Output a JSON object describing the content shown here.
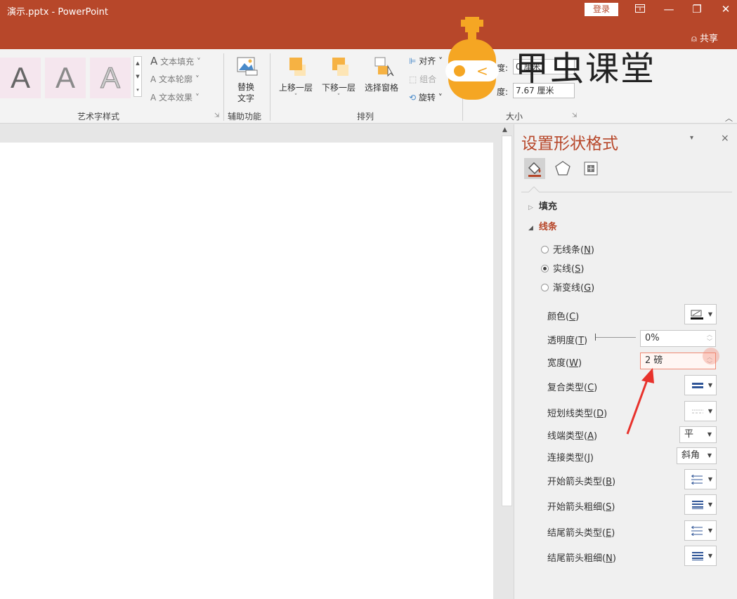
{
  "titlebar": {
    "title": "演示.pptx  -  PowerPoint",
    "login": "登录",
    "share": "共享",
    "restore_icon": "ribbon-display-icon",
    "minimize": "—",
    "maximize": "❐",
    "close": "✕"
  },
  "ribbon": {
    "wordart": {
      "letter": "A",
      "text_fill": "文本填充",
      "text_outline": "文本轮廓",
      "text_effects": "文本效果",
      "group_label": "艺术字样式"
    },
    "accessibility": {
      "alt_text_line1": "替换",
      "alt_text_line2": "文字",
      "group_label": "辅助功能"
    },
    "arrange": {
      "bring_forward": "上移一层",
      "send_backward": "下移一层",
      "selection_pane": "选择窗格",
      "align": "对齐",
      "group": "组合",
      "rotate": "旋转",
      "group_label": "排列"
    },
    "size": {
      "height_label": "度:",
      "height_value": "0 厘米",
      "width_label": "度:",
      "width_value": "7.67 厘米",
      "group_label": "大小"
    }
  },
  "watermark": {
    "text": "甲虫课堂"
  },
  "pane": {
    "title": "设置形状格式",
    "tabs": [
      "fill-line",
      "effects",
      "size-properties"
    ],
    "fill_section": "填充",
    "line_section": "线条",
    "line_options": [
      {
        "label": "无线条(",
        "key": "N",
        "selected": false
      },
      {
        "label": "实线(",
        "key": "S",
        "selected": true
      },
      {
        "label": "渐变线(",
        "key": "G",
        "selected": false
      }
    ],
    "props": {
      "color": {
        "label": "颜色(",
        "key": "C"
      },
      "transparency": {
        "label": "透明度(",
        "key": "T",
        "value": "0%"
      },
      "width": {
        "label": "宽度(",
        "key": "W",
        "value": "2 磅"
      },
      "compound": {
        "label": "复合类型(",
        "key": "C"
      },
      "dash": {
        "label": "短划线类型(",
        "key": "D"
      },
      "cap": {
        "label": "线端类型(",
        "key": "A",
        "value": "平"
      },
      "join": {
        "label": "连接类型(",
        "key": "J",
        "value": "斜角"
      },
      "begin_arrow_type": {
        "label": "开始箭头类型(",
        "key": "B"
      },
      "begin_arrow_size": {
        "label": "开始箭头粗细(",
        "key": "S"
      },
      "end_arrow_type": {
        "label": "结尾箭头类型(",
        "key": "E"
      },
      "end_arrow_size": {
        "label": "结尾箭头粗细(",
        "key": "N"
      }
    }
  },
  "colors": {
    "accent": "#b7472a",
    "logo_orange": "#f5a623"
  }
}
